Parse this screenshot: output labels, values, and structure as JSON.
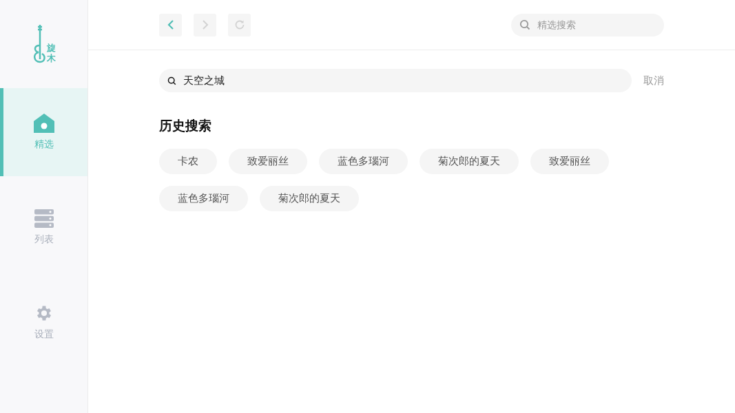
{
  "logo": {
    "text": "旋木"
  },
  "sidebar": {
    "items": [
      {
        "label": "精选",
        "kind": "home",
        "selected": true
      },
      {
        "label": "列表",
        "kind": "list",
        "selected": false
      },
      {
        "label": "设置",
        "kind": "gear",
        "selected": false
      }
    ]
  },
  "toolbar": {
    "buttons": [
      {
        "kind": "back",
        "disabled": false
      },
      {
        "kind": "forward",
        "disabled": true
      },
      {
        "kind": "refresh",
        "disabled": true
      }
    ],
    "search": {
      "placeholder": "精选搜索"
    }
  },
  "search": {
    "value": "天空之城",
    "cancel": "取消"
  },
  "history": {
    "title": "历史搜索",
    "tags": [
      {
        "label": "卡农"
      },
      {
        "label": "致爱丽丝"
      },
      {
        "label": "蓝色多瑙河"
      },
      {
        "label": "菊次郎的夏天"
      },
      {
        "label": "致爱丽丝"
      },
      {
        "label": "蓝色多瑙河"
      },
      {
        "label": "菊次郎的夏天"
      }
    ]
  }
}
